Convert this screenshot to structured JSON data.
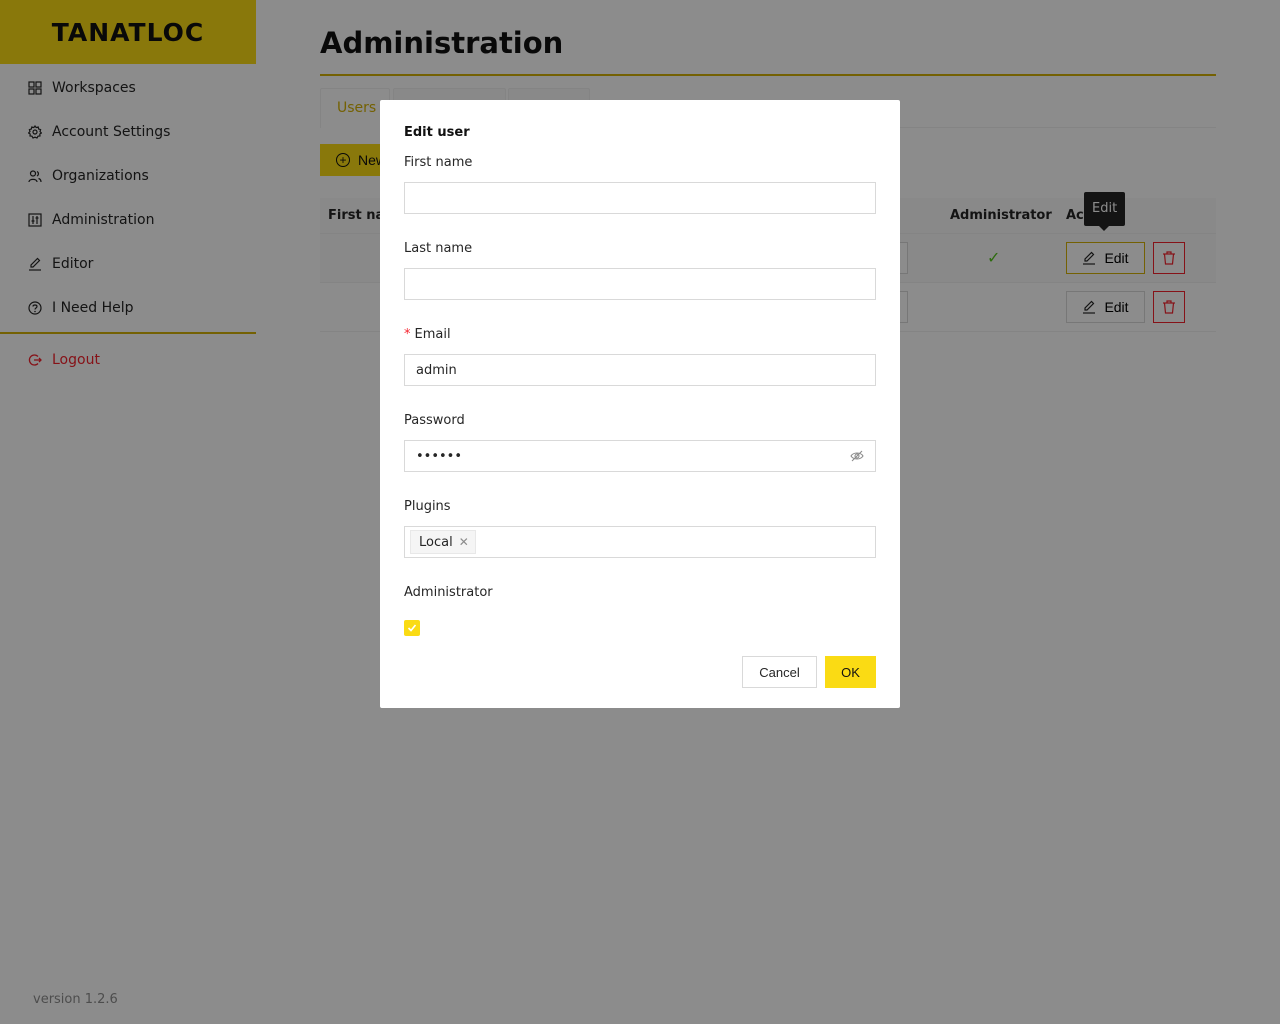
{
  "brand": {
    "logo_text": "TANATLOC",
    "accent": "#fadb14",
    "accent_dark": "#d4b106"
  },
  "sidebar": {
    "items": [
      {
        "label": "Workspaces",
        "icon": "grid-icon"
      },
      {
        "label": "Account Settings",
        "icon": "gear-icon"
      },
      {
        "label": "Organizations",
        "icon": "team-icon"
      },
      {
        "label": "Administration",
        "icon": "control-icon"
      },
      {
        "label": "Editor",
        "icon": "edit-icon"
      },
      {
        "label": "I Need Help",
        "icon": "question-icon"
      }
    ],
    "logout": "Logout",
    "version": "version 1.2.6"
  },
  "main": {
    "title": "Administration",
    "tabs": [
      {
        "label": "Users",
        "active": true
      },
      {
        "label": ""
      },
      {
        "label": ""
      }
    ],
    "new_button": "New",
    "table": {
      "headers": [
        "First name",
        "Administrator",
        "Actions"
      ],
      "rows": [
        {
          "administrator": true,
          "edit_label": "Edit"
        },
        {
          "administrator": false,
          "edit_label": "Edit"
        }
      ]
    },
    "tooltip": "Edit"
  },
  "modal": {
    "title": "Edit user",
    "first_name": {
      "label": "First name",
      "value": ""
    },
    "last_name": {
      "label": "Last name",
      "value": ""
    },
    "email": {
      "label": "Email",
      "required_mark": "*",
      "value": "admin"
    },
    "password": {
      "label": "Password",
      "value": "••••••"
    },
    "plugins": {
      "label": "Plugins",
      "tags": [
        "Local"
      ]
    },
    "administrator": {
      "label": "Administrator",
      "checked": true
    },
    "cancel": "Cancel",
    "ok": "OK"
  }
}
